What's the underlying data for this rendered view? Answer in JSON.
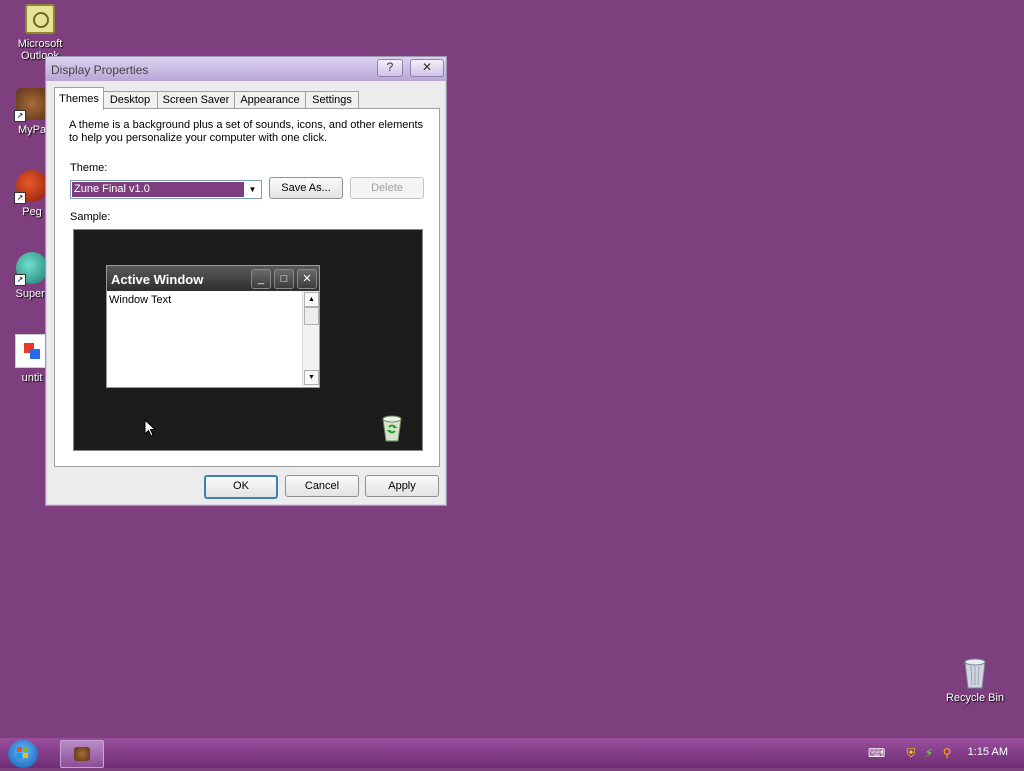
{
  "desktop": {
    "icons": [
      {
        "label": "Microsoft Outlook",
        "icon": "outlook-icon"
      },
      {
        "label": "MyPa",
        "icon": "mypa-icon"
      },
      {
        "label": "Peg",
        "icon": "peg-icon"
      },
      {
        "label": "Superr",
        "icon": "superr-icon"
      },
      {
        "label": "untit",
        "icon": "untitled-icon"
      }
    ],
    "recycle_bin": "Recycle Bin",
    "background_color": "#7e3f7e"
  },
  "dialog": {
    "title": "Display Properties",
    "help_button": "?",
    "close_button": "✕",
    "tabs": [
      "Themes",
      "Desktop",
      "Screen Saver",
      "Appearance",
      "Settings"
    ],
    "active_tab": "Themes",
    "description": "A theme is a background plus a set of sounds, icons, and other elements to help you personalize your computer with one click.",
    "theme_label": "Theme:",
    "theme_value": "Zune Final v1.0",
    "save_as": "Save As...",
    "delete": "Delete",
    "sample_label": "Sample:",
    "sample_window": {
      "title": "Active Window",
      "text": "Window Text"
    },
    "ok": "OK",
    "cancel": "Cancel",
    "apply": "Apply"
  },
  "taskbar": {
    "clock": "1:15 AM"
  }
}
